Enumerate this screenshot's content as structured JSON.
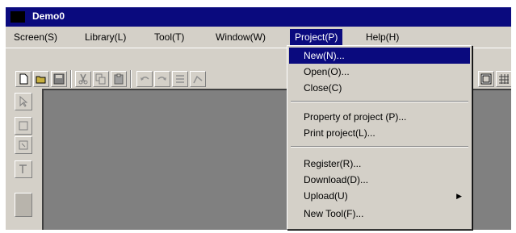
{
  "window": {
    "title": "Demo0"
  },
  "menubar": [
    {
      "label": "Screen(S)"
    },
    {
      "label": "Library(L)"
    },
    {
      "label": "Tool(T)"
    },
    {
      "label": "Window(W)"
    },
    {
      "label": "Project(P)"
    },
    {
      "label": "Help(H)"
    }
  ],
  "project_menu": {
    "items": [
      {
        "label": "New(N)..."
      },
      {
        "label": "Open(O)..."
      },
      {
        "label": "Close(C)"
      },
      {
        "label": "Property of project (P)..."
      },
      {
        "label": "Print project(L)..."
      },
      {
        "label": "Register(R)..."
      },
      {
        "label": "Download(D)..."
      },
      {
        "label": "Upload(U)"
      },
      {
        "label": "New Tool(F)..."
      }
    ]
  },
  "colors": {
    "titlebar": "#0a0a7e",
    "highlight": "#0a0a7e",
    "face": "#d4d0c8",
    "workspace": "#808080"
  },
  "icons": [
    "new-file-icon",
    "open-folder-icon",
    "save-icon",
    "cut-icon",
    "copy-icon",
    "paste-icon",
    "undo-icon",
    "redo-icon",
    "pointer-icon",
    "grid-icon"
  ]
}
